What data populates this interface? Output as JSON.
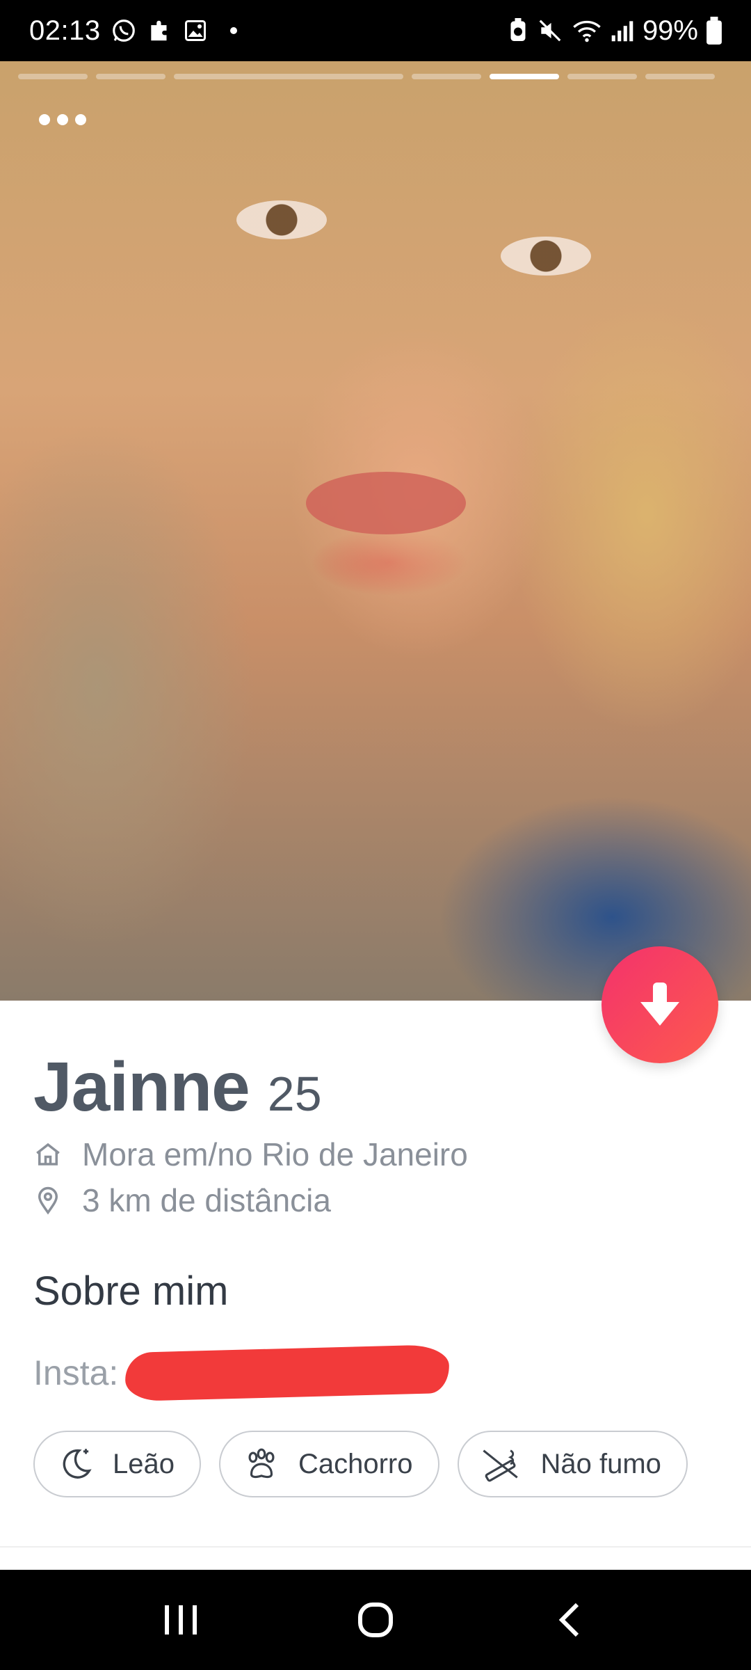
{
  "status_bar": {
    "time": "02:13",
    "battery_percent": "99%"
  },
  "photo": {
    "segments_total": 9,
    "active_segment": 7
  },
  "profile": {
    "name": "Jainne",
    "age": "25",
    "lives_in": "Mora em/no Rio de Janeiro",
    "distance": "3 km de distância"
  },
  "about": {
    "title": "Sobre mim",
    "bio_prefix": "Insta: "
  },
  "chips": [
    {
      "label": "Leão",
      "icon": "moon-star-icon"
    },
    {
      "label": "Cachorro",
      "icon": "paw-icon"
    },
    {
      "label": "Não fumo",
      "icon": "no-smoking-icon"
    }
  ],
  "colors": {
    "accent_start": "#f3326c",
    "accent_end": "#fd5a4e",
    "name_text": "#505965",
    "muted_text": "#8a9099",
    "redaction": "#f23a3a"
  }
}
